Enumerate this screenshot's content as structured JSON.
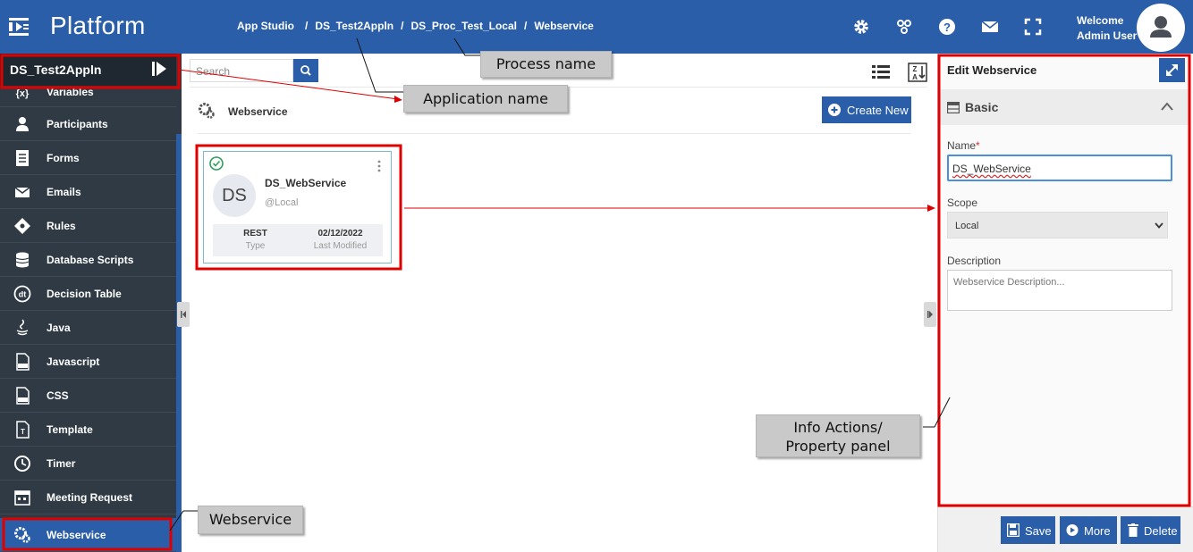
{
  "header": {
    "app_name": "Platform",
    "breadcrumb": [
      "App Studio",
      "DS_Test2Appln",
      "DS_Proc_Test_Local",
      "Webservice"
    ],
    "breadcrumb_sep": "/",
    "welcome": "Welcome",
    "user": "Admin User",
    "icons": [
      "settings-icon",
      "network-icon",
      "help-icon",
      "mail-icon",
      "fullscreen-icon"
    ]
  },
  "sidebar": {
    "title": "DS_Test2Appln",
    "items": [
      {
        "label": "Variables",
        "icon": "variables-icon"
      },
      {
        "label": "Participants",
        "icon": "participants-icon"
      },
      {
        "label": "Forms",
        "icon": "forms-icon"
      },
      {
        "label": "Emails",
        "icon": "emails-icon"
      },
      {
        "label": "Rules",
        "icon": "rules-icon"
      },
      {
        "label": "Database Scripts",
        "icon": "database-icon"
      },
      {
        "label": "Decision Table",
        "icon": "decision-table-icon"
      },
      {
        "label": "Java",
        "icon": "java-icon"
      },
      {
        "label": "Javascript",
        "icon": "javascript-icon"
      },
      {
        "label": "CSS",
        "icon": "css-icon"
      },
      {
        "label": "Template",
        "icon": "template-icon"
      },
      {
        "label": "Timer",
        "icon": "timer-icon"
      },
      {
        "label": "Meeting Request",
        "icon": "meeting-icon"
      },
      {
        "label": "Webservice",
        "icon": "webservice-icon"
      }
    ]
  },
  "main": {
    "search_placeholder": "Search",
    "section_title": "Webservice",
    "create_label": "Create New",
    "card": {
      "initials": "DS",
      "name": "DS_WebService",
      "scope": "@Local",
      "type_value": "REST",
      "type_label": "Type",
      "modified_value": "02/12/2022",
      "modified_label": "Last Modified"
    }
  },
  "panel": {
    "title": "Edit Webservice",
    "section": "Basic",
    "name_label": "Name",
    "required_mark": "*",
    "name_value": "DS_WebService",
    "scope_label": "Scope",
    "scope_value": "Local",
    "description_label": "Description",
    "description_placeholder": "Webservice Description...",
    "save_label": "Save",
    "more_label": "More",
    "delete_label": "Delete"
  },
  "annotations": {
    "process_name": "Process name",
    "application_name": "Application name",
    "info_actions_line1": "Info Actions/",
    "info_actions_line2": "Property panel",
    "webservice": "Webservice"
  },
  "colors": {
    "brand": "#2a5ea8",
    "sidebar_bg": "#2f3a44",
    "highlight": "#e00000"
  }
}
